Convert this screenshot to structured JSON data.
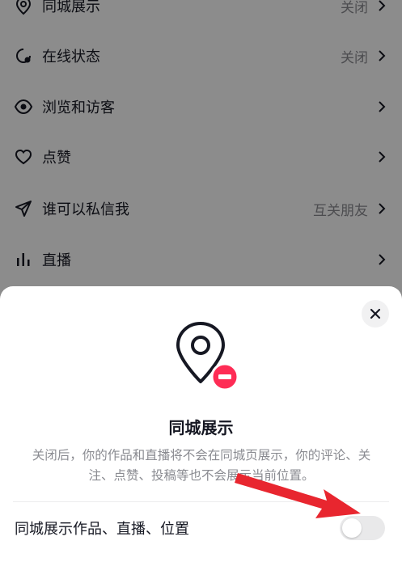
{
  "settings_list": [
    {
      "label": "同城展示",
      "value": "关闭",
      "icon": "location-pin-icon"
    },
    {
      "label": "在线状态",
      "value": "关闭",
      "icon": "online-status-icon"
    },
    {
      "label": "浏览和访客",
      "value": "",
      "icon": "eye-icon"
    },
    {
      "label": "点赞",
      "value": "",
      "icon": "heart-icon"
    },
    {
      "label": "谁可以私信我",
      "value": "互关朋友",
      "icon": "send-icon"
    },
    {
      "label": "直播",
      "value": "",
      "icon": "live-bars-icon"
    }
  ],
  "sheet": {
    "title": "同城展示",
    "description": "关闭后，你的作品和直播将不会在同城页展示，你的评论、关注、点赞、投稿等也不会展示当前位置。",
    "toggle_label": "同城展示作品、直播、位置",
    "toggle_on": false,
    "close_icon": "close-icon",
    "hero_icon": "location-pin-minus-icon"
  },
  "colors": {
    "accent_red": "#fe2c55",
    "arrow_red": "#e8262f"
  }
}
